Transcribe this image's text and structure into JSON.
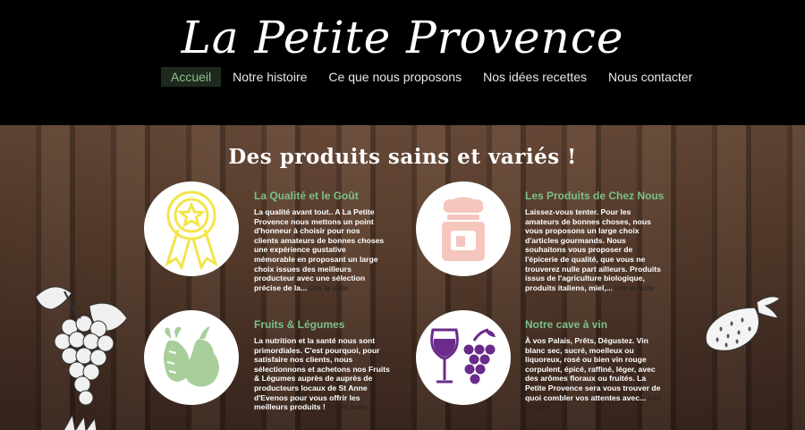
{
  "site": {
    "logo": "La Petite Provence"
  },
  "nav": [
    {
      "label": "Accueil",
      "active": true
    },
    {
      "label": "Notre histoire"
    },
    {
      "label": "Ce que nous proposons"
    },
    {
      "label": "Nos idées recettes"
    },
    {
      "label": "Nous contacter"
    }
  ],
  "hero": {
    "title": "Des produits sains et variés !"
  },
  "features": [
    {
      "title": "La Qualité et le Goût",
      "text": "La qualité avant tout.. A La Petite Provence nous mettons un point d'honneur à choisir pour nos clients amateurs de bonnes choses une expérience gustative mémorable en proposant un large choix issues des meilleurs producteur avec une sélection précise de la...",
      "more": "Lire la suite",
      "icon": "award-ribbon-icon"
    },
    {
      "title": "Les Produits de Chez Nous",
      "text": "Laissez-vous tenter.  Pour les amateurs de bonnes choses, nous vous proposons un large choix d'articles gourmands. Nous souhaitons vous proposer de l'épicerie de qualité, que vous ne trouverez nulle part ailleurs. Produits issus de l'agriculture biologique, produits italiens, miel,...",
      "more": "Lire la suite",
      "icon": "jam-jar-icon"
    },
    {
      "title": "Fruits & Légumes",
      "text": "La nutrition et la santé nous sont primordiales. C'est pourquoi, pour satisfaire nos clients, nous sélectionnons et achetons nos Fruits & Légumes auprès de auprès de producteurs locaux de St Anne d'Evenos pour vous offrir les meilleurs produits !",
      "more": "Lire la suite",
      "icon": "pear-radish-icon"
    },
    {
      "title": "Notre cave à vin",
      "text": "À vos Palais, Prêts, Dégustez. Vin blanc sec, sucré, moelleux ou liquoreux, rosé ou bien vin rouge corpulent, épicé, raffiné, léger, avec des arômes floraux ou fruités. La Petite Provence sera vous trouver de quoi combler vos attentes avec...",
      "more": "Lire la suite",
      "icon": "wine-glass-grapes-icon"
    }
  ],
  "colors": {
    "accent": "#7cc08a",
    "header_bg": "#000000",
    "award": "#f2e54a",
    "jar": "#f5c6bd",
    "veg": "#a8cf9a",
    "wine": "#6b2b8a"
  }
}
